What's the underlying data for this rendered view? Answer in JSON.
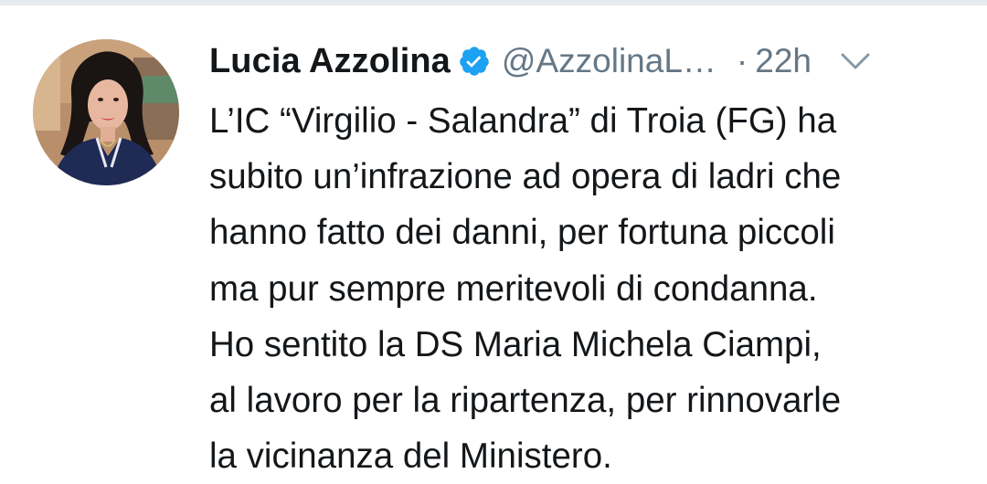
{
  "tweet": {
    "author": {
      "display_name": "Lucia Azzolina",
      "handle": "@AzzolinaL…",
      "verified": true,
      "verified_icon": "verified-badge-icon",
      "avatar_icon": "profile-photo"
    },
    "separator": "·",
    "timestamp": "22h",
    "menu_icon": "chevron-down-icon",
    "text_lines": [
      "L’IC “Virgilio - Salandra” di Troia (FG) ha",
      "subito un’infrazione ad opera di ladri che",
      "hanno fatto dei danni, per fortuna piccoli",
      "ma pur sempre meritevoli di condanna.",
      "Ho sentito la DS Maria Michela Ciampi,",
      "al lavoro per la ripartenza, per rinnovarle",
      "la vicinanza del Ministero."
    ]
  },
  "colors": {
    "text_primary": "#14171a",
    "text_secondary": "#657786",
    "verified_blue": "#1da1f2",
    "divider": "#e6ecf0",
    "background": "#ffffff"
  }
}
